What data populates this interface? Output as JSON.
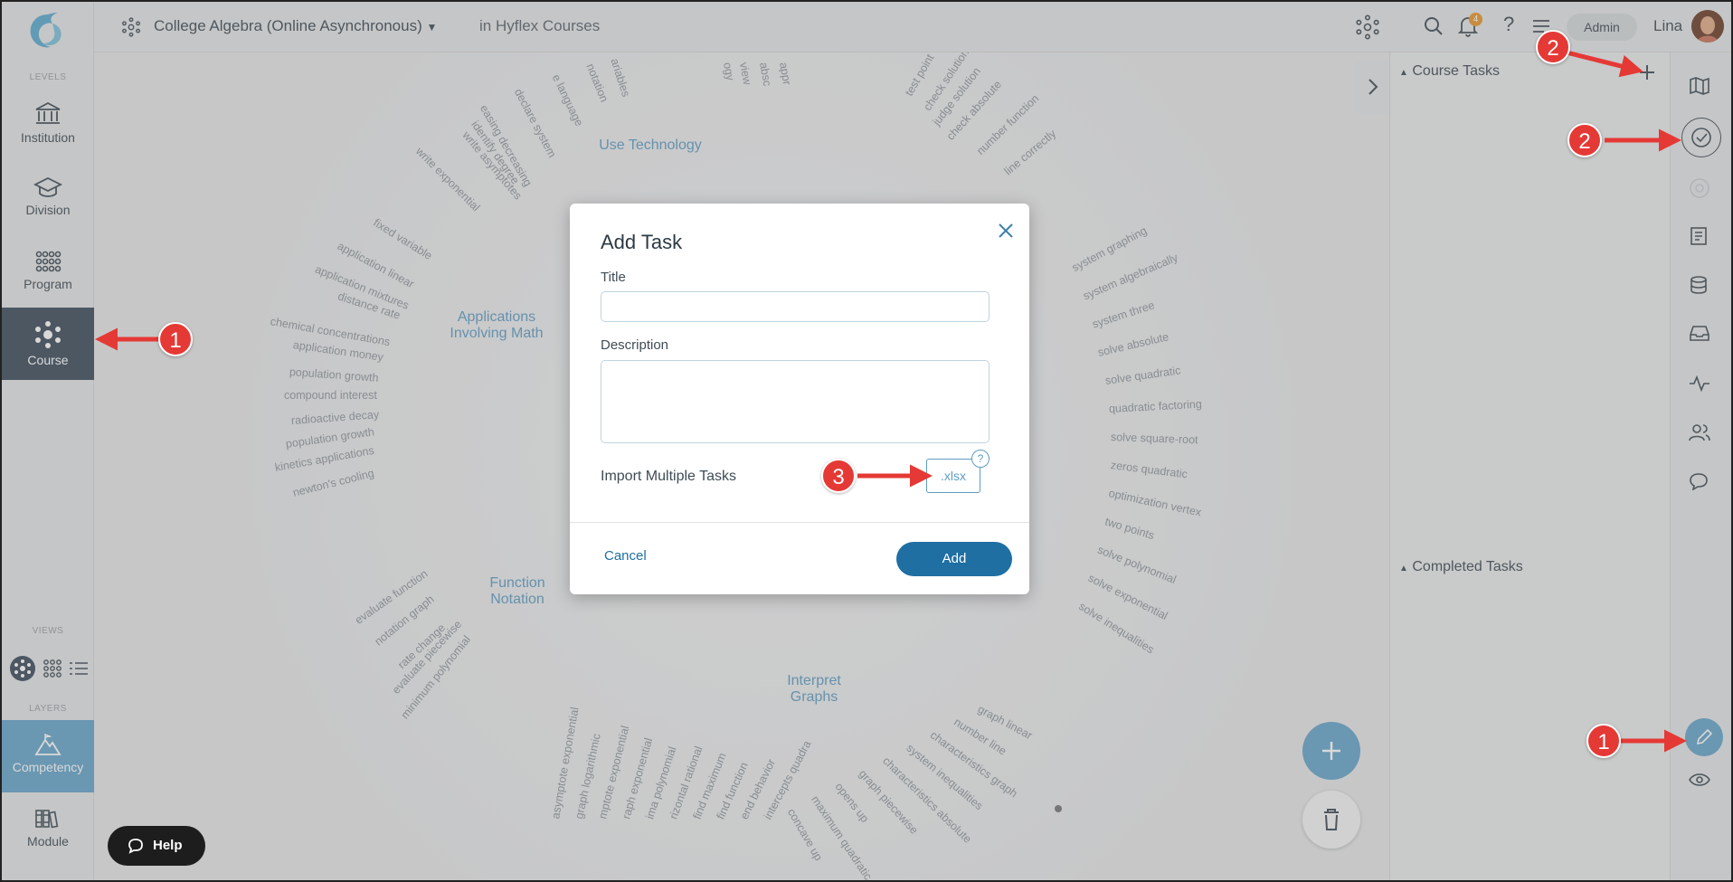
{
  "sidebar": {
    "levels_label": "LEVELS",
    "items": [
      {
        "label": "Institution"
      },
      {
        "label": "Division"
      },
      {
        "label": "Program"
      },
      {
        "label": "Course"
      }
    ],
    "views_label": "VIEWS",
    "layers_label": "LAYERS",
    "layers": [
      {
        "label": "Competency"
      },
      {
        "label": "Module"
      }
    ]
  },
  "topbar": {
    "course_title": "College Algebra (Online Asynchronous)",
    "context": "in Hyflex Courses",
    "notification_count": "4",
    "admin_label": "Admin",
    "user_name": "Lina"
  },
  "canvas": {
    "categories": [
      "Use Technology",
      "Applications Involving Math",
      "Function Notation",
      "Interpret Graphs"
    ],
    "words_top_left": [
      "fixed variable",
      "application linear",
      "application mixtures",
      "distance rate",
      "chemical concentrations",
      "application money",
      "population growth",
      "compound interest",
      "radioactive decay",
      "population growth",
      "kinetics applications",
      "newton's cooling"
    ],
    "words_top_arc": [
      "write exponential",
      "write asymptotes",
      "identify degree",
      "easing decreasing",
      "declare system",
      "e language",
      "notation",
      "ariables"
    ],
    "words_top_center": [
      "ogy",
      "view",
      "absc",
      "appr"
    ],
    "words_top_right": [
      "test point",
      "check solution",
      "judge solution",
      "check absolute",
      "number function",
      "line correctly"
    ],
    "words_right": [
      "system graphing",
      "system algebraically",
      "system three",
      "solve absolute",
      "solve quadratic",
      "quadratic factoring",
      "solve square-root",
      "zeros quadratic",
      "optimization vertex",
      "two points",
      "solve polynomial",
      "solve exponential",
      "solve inequalities"
    ],
    "words_bottom_left": [
      "evaluate function",
      "notation graph",
      "rate change",
      "evaluate piecewise",
      "minimum polynomial"
    ],
    "words_bottom": [
      "asymptote exponential",
      "graph logarithmic",
      "mptote exponential",
      "raph exponential",
      "ima polynomial",
      "rizontal rational",
      "find maximum",
      "find function",
      "end behavior",
      "intercepts quadra",
      "concave up",
      "maximum quadratic",
      "opens up",
      "graph piecewise",
      "characteristics absolute",
      "system inequalities",
      "characteristics graph",
      "number line",
      "graph linear"
    ]
  },
  "right_panel": {
    "course_tasks": "Course Tasks",
    "completed_tasks": "Completed Tasks"
  },
  "modal": {
    "title": "Add Task",
    "title_label": "Title",
    "title_value": "",
    "description_label": "Description",
    "description_value": "",
    "import_label": "Import Multiple Tasks",
    "import_button": ".xlsx",
    "help_glyph": "?",
    "cancel": "Cancel",
    "add": "Add"
  },
  "help_button": "Help",
  "callouts": [
    "1",
    "2",
    "2",
    "3",
    "1"
  ],
  "colors": {
    "accent": "#1f6fa3",
    "category": "#5f9cc2",
    "callout": "#e53935",
    "course_active": "#3c4c5b",
    "competency": "#66a4c9"
  }
}
